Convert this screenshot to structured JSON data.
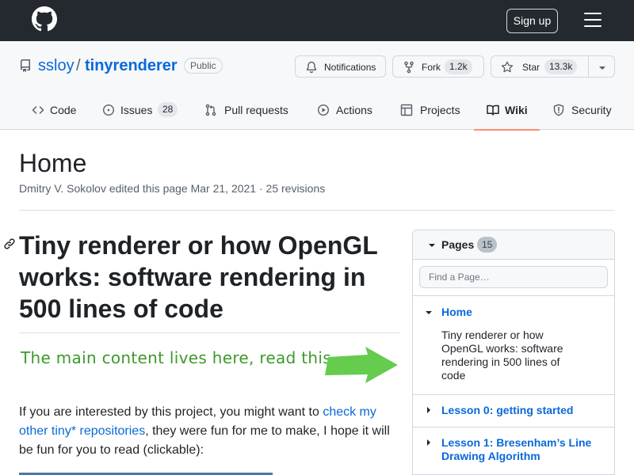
{
  "header": {
    "signup_label": "Sign up"
  },
  "repo": {
    "owner": "ssloy",
    "separator": "/",
    "name": "tinyrenderer",
    "visibility": "Public",
    "notifications_label": "Notifications",
    "fork_label": "Fork",
    "fork_count": "1.2k",
    "star_label": "Star",
    "star_count": "13.3k"
  },
  "tabs": [
    {
      "label": "Code",
      "icon": "code-icon"
    },
    {
      "label": "Issues",
      "count": "28",
      "icon": "issue-icon"
    },
    {
      "label": "Pull requests",
      "icon": "pull-request-icon"
    },
    {
      "label": "Actions",
      "icon": "play-icon"
    },
    {
      "label": "Projects",
      "icon": "table-icon"
    },
    {
      "label": "Wiki",
      "icon": "book-icon",
      "selected": true
    },
    {
      "label": "Security",
      "icon": "shield-icon"
    }
  ],
  "wiki": {
    "title": "Home",
    "meta": "Dmitry V. Sokolov edited this page Mar 21, 2021 · 25 revisions"
  },
  "content": {
    "heading": "Tiny renderer or how OpenGL works: software rendering in 500 lines of code",
    "note": "The main content lives here, read this",
    "para_before": "If you are interested by this project, you might want to ",
    "para_link": "check my other tiny* repositories",
    "para_after": ", they were fun for me to make, I hope it will be fun for you to read (clickable):"
  },
  "sidebar": {
    "title": "Pages",
    "count": "15",
    "search_placeholder": "Find a Page…",
    "items": [
      {
        "title": "Home",
        "desc": "Tiny renderer or how OpenGL works: software rendering in 500 lines of code",
        "expanded": true
      },
      {
        "title": "Lesson 0: getting started",
        "expanded": false
      },
      {
        "title": "Lesson 1: Bresenham’s Line Drawing Algorithm",
        "expanded": false
      }
    ]
  },
  "colors": {
    "header_bg": "#24292f",
    "link": "#0969da",
    "selected_tab_underline": "#fd8c73",
    "note_green": "#3d9a2a",
    "arrow_green": "#66cc4d"
  }
}
